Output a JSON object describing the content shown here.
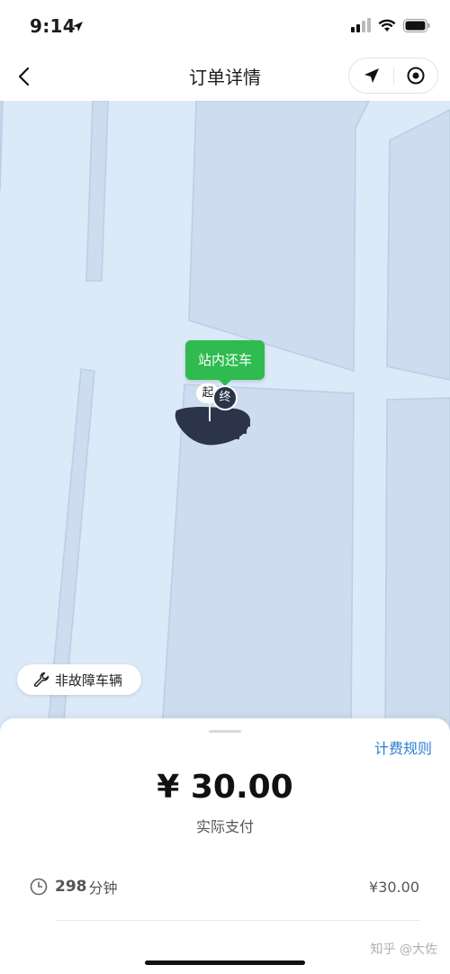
{
  "status_bar": {
    "time": "9:14",
    "icons": [
      "location-arrow-icon",
      "signal-icon",
      "wifi-icon",
      "battery-icon"
    ]
  },
  "nav": {
    "title": "订单详情",
    "back_icon": "chevron-left-icon",
    "capsule_icons": [
      "navigation-arrow-icon",
      "target-icon"
    ]
  },
  "map": {
    "station_label": "站内还车",
    "start_marker": "起",
    "end_marker": "终",
    "fault_button": "非故障车辆",
    "colors": {
      "background": "#dbe9f8",
      "block": "#cddcee",
      "road_edge": "#b9cfe6",
      "pin": "#2fbb4f"
    }
  },
  "sheet": {
    "rules_link": "计费规则",
    "amount": "¥ 30.00",
    "amount_label": "实际支付",
    "duration_value": "298",
    "duration_unit": "分钟",
    "duration_price": "¥30.00",
    "watermark": "知乎 @大佐"
  },
  "colors": {
    "accent_blue": "#2e7fd0",
    "accent_green": "#2fbb4f"
  }
}
